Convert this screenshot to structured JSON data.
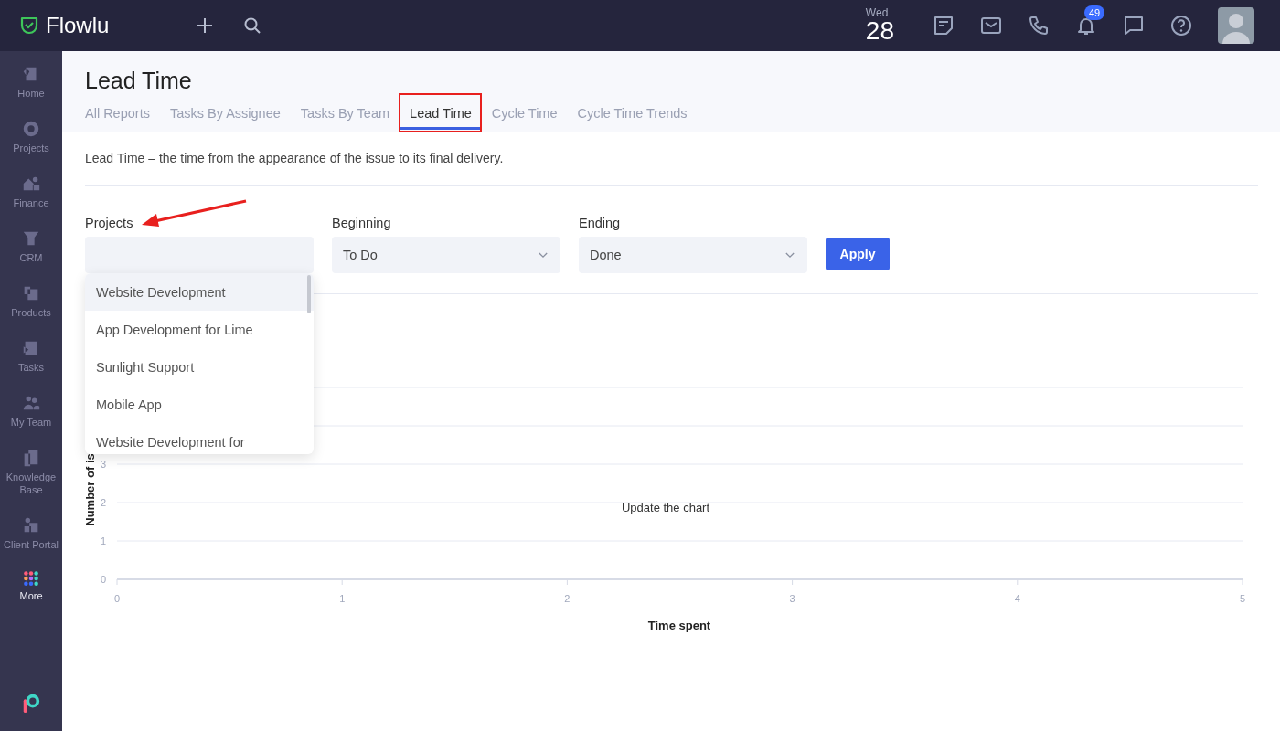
{
  "topbar": {
    "logo": "Flowlu",
    "date": {
      "weekday": "Wed",
      "day": "28"
    },
    "notifications_badge": "49"
  },
  "sidebar": {
    "items": [
      {
        "label": "Home",
        "kind": "module",
        "selected": false
      },
      {
        "label": "Projects",
        "kind": "module",
        "selected": false
      },
      {
        "label": "Finance",
        "kind": "module",
        "selected": false
      },
      {
        "label": "CRM",
        "kind": "module",
        "selected": false
      },
      {
        "label": "Products",
        "kind": "module",
        "selected": false
      },
      {
        "label": "Tasks",
        "kind": "module",
        "selected": false
      },
      {
        "label": "My Team",
        "kind": "module",
        "selected": false
      },
      {
        "label": "Knowledge Base",
        "kind": "module",
        "selected": false
      },
      {
        "label": "Client Portal",
        "kind": "module",
        "selected": false
      },
      {
        "label": "More",
        "kind": "more",
        "selected": true
      }
    ]
  },
  "page": {
    "title": "Lead Time",
    "tabs": [
      {
        "label": "All Reports",
        "selected": false
      },
      {
        "label": "Tasks By Assignee",
        "selected": false
      },
      {
        "label": "Tasks By Team",
        "selected": false
      },
      {
        "label": "Lead Time",
        "selected": true
      },
      {
        "label": "Cycle Time",
        "selected": false
      },
      {
        "label": "Cycle Time Trends",
        "selected": false
      }
    ],
    "description": "Lead Time – the time from the appearance of the issue to its final delivery.",
    "filters": [
      {
        "kind": "multiselect",
        "label": "Projects",
        "open": true
      },
      {
        "kind": "select",
        "label": "Beginning",
        "value": "To Do"
      },
      {
        "kind": "select",
        "label": "Ending",
        "value": "Done"
      }
    ],
    "apply_button": "Apply",
    "projects_dropdown": [
      {
        "label": "Website Development",
        "selected": true
      },
      {
        "label": "App Development for Lime",
        "selected": false
      },
      {
        "label": "Sunlight Support",
        "selected": false
      },
      {
        "label": "Mobile App",
        "selected": false
      },
      {
        "label": "Website Development for",
        "selected": false
      }
    ],
    "chart": {
      "message": "Update the chart",
      "chart_data": {
        "type": "line",
        "grid": true,
        "xlabel": "Time spent",
        "ylabel": "Number of is",
        "xlim": [
          0,
          5
        ],
        "ylim": [
          0,
          5
        ],
        "xticks": [
          0,
          1,
          2,
          3,
          4,
          5
        ],
        "yticks": [
          0,
          1,
          2,
          3
        ]
      }
    }
  }
}
